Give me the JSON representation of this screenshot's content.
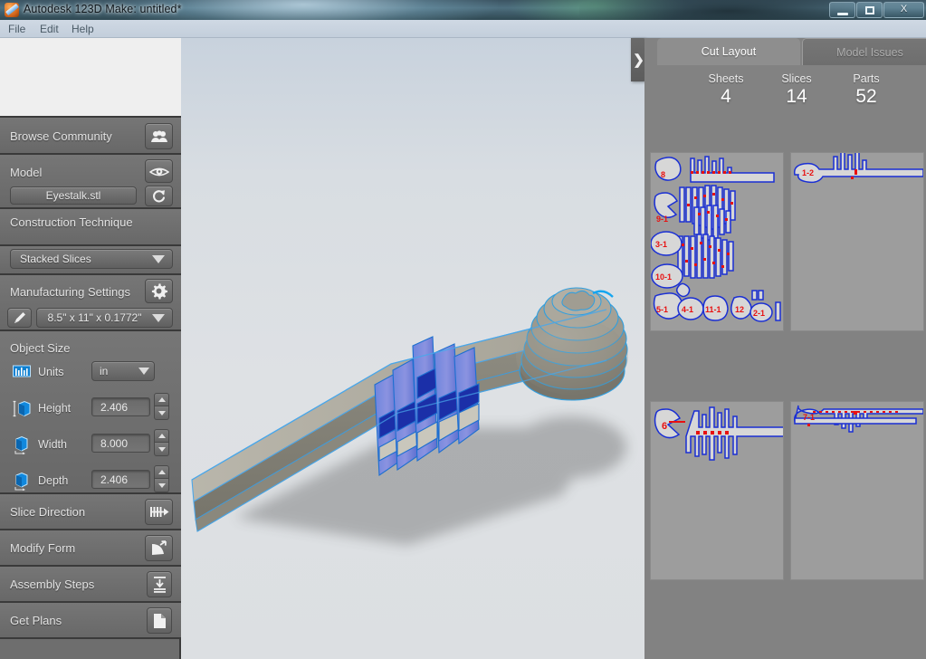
{
  "window": {
    "title": "Autodesk 123D Make: untitled*",
    "app_icon": "app-logo-icon",
    "minimize_label": "–",
    "maximize_label": "❐",
    "close_label": "X"
  },
  "menu": {
    "items": [
      {
        "label": "File"
      },
      {
        "label": "Edit"
      },
      {
        "label": "Help"
      }
    ]
  },
  "sidebar": {
    "browse": {
      "label": "Browse Community",
      "icon": "people-icon"
    },
    "model": {
      "label": "Model",
      "eye_icon": "eye-icon",
      "refresh_icon": "refresh-icon",
      "file_name": "Eyestalk.stl"
    },
    "construction": {
      "label": "Construction Technique",
      "selected": "Stacked Slices",
      "caret_icon": "chevron-down-icon"
    },
    "manufacturing": {
      "label": "Manufacturing Settings",
      "gear_icon": "gear-icon",
      "pencil_icon": "pencil-icon",
      "selected": "8.5\" x 11\" x 0.1772\"",
      "caret_icon": "chevron-down-icon"
    },
    "object_size": {
      "label": "Object Size",
      "units": {
        "label": "Units",
        "value": "in",
        "icon": "ruler-icon"
      },
      "height": {
        "label": "Height",
        "value": "2.406",
        "icon": "height-cube-icon"
      },
      "width": {
        "label": "Width",
        "value": "8.000",
        "icon": "width-cube-icon"
      },
      "depth": {
        "label": "Depth",
        "value": "2.406",
        "icon": "depth-cube-icon"
      }
    },
    "slice_direction": {
      "label": "Slice Direction",
      "icon": "slice-direction-icon"
    },
    "modify_form": {
      "label": "Modify Form",
      "icon": "modify-form-icon"
    },
    "assembly_steps": {
      "label": "Assembly Steps",
      "icon": "assembly-steps-icon"
    },
    "get_plans": {
      "label": "Get Plans",
      "icon": "document-icon"
    }
  },
  "right_panel": {
    "collapse_icon": "chevron-right-icon",
    "tabs": [
      {
        "label": "Cut Layout",
        "active": true
      },
      {
        "label": "Model Issues",
        "active": false
      }
    ],
    "stats": [
      {
        "key": "Sheets",
        "value": "4"
      },
      {
        "key": "Slices",
        "value": "14"
      },
      {
        "key": "Parts",
        "value": "52"
      }
    ],
    "sheets": [
      {
        "id": "sheet-1",
        "part_labels": [
          "8",
          "9-1",
          "3-1",
          "10-1",
          "5-1",
          "4-1",
          "11-1",
          "12",
          "2-1"
        ]
      },
      {
        "id": "sheet-2",
        "part_labels": [
          "1-2"
        ]
      },
      {
        "id": "sheet-3",
        "part_labels": [
          "6"
        ]
      },
      {
        "id": "sheet-4",
        "part_labels": [
          "7-1"
        ]
      }
    ]
  },
  "colors": {
    "part_outline": "#1a2fd4",
    "part_fill": "#d7d7d7",
    "part_label": "#e81010",
    "sheet_bg": "#9d9d9d",
    "panel_bg": "#828282",
    "sidebar_bg": "#6e6e6e",
    "viewport_bg": "#dcdfe2",
    "model_highlight": "#0a9ceb"
  }
}
